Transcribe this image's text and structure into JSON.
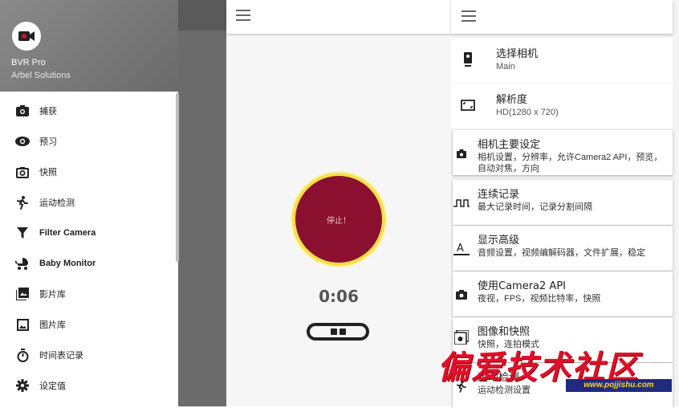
{
  "drawer": {
    "app_name": "BVR Pro",
    "company": "Arbel Solutions",
    "items": [
      {
        "label": "捕获",
        "icon": "camera-icon"
      },
      {
        "label": "预习",
        "icon": "eye-icon"
      },
      {
        "label": "快照",
        "icon": "camera-snapshot-icon"
      },
      {
        "label": "运动检测",
        "icon": "running-person-icon"
      },
      {
        "label": "Filter Camera",
        "icon": "filter-icon"
      },
      {
        "label": "Baby Monitor",
        "icon": "stroller-icon"
      },
      {
        "label": "影片库",
        "icon": "video-library-icon"
      },
      {
        "label": "图片库",
        "icon": "image-library-icon"
      },
      {
        "label": "时间表记录",
        "icon": "stopwatch-icon"
      },
      {
        "label": "设定值",
        "icon": "gear-icon"
      }
    ]
  },
  "recorder": {
    "stop_label": "停止！",
    "timer": "0:06"
  },
  "settings": {
    "plain_items": [
      {
        "title": "选择相机",
        "subtitle": "Main",
        "icon": "phone-camera-icon"
      },
      {
        "title": "解析度",
        "subtitle": "HD(1280 x 720)",
        "icon": "resolution-icon"
      }
    ],
    "cards": [
      {
        "title": "相机主要设定",
        "subtitle": "相机设置，分辨率，允许Camera2 API，预览，自动对焦，方向",
        "icon": "camera-icon"
      },
      {
        "title": "连续记录",
        "subtitle": "最大记录时间，记录分割间隔",
        "icon": "pulse-wave-icon"
      },
      {
        "title": "显示高级",
        "subtitle": "音频设置，视频编解码器，文件扩展，稳定",
        "icon": "text-format-icon"
      },
      {
        "title": "使用Camera2 API",
        "subtitle": "夜视，FPS，视频比特率，快照",
        "icon": "camera-icon"
      },
      {
        "title": "图像和快照",
        "subtitle": "快照，连拍模式",
        "icon": "image-stack-icon"
      },
      {
        "title": "运动检测",
        "subtitle": "运动检测设置",
        "icon": "running-person-icon"
      }
    ]
  },
  "watermark": {
    "text": "偏爱技术社区",
    "url": "www.pojjishu.com"
  },
  "colors": {
    "stop_fill": "#8b1030",
    "stop_ring": "#f4e04a",
    "drawer_header": "#7a7a7a",
    "watermark_red": "#e0102a"
  }
}
